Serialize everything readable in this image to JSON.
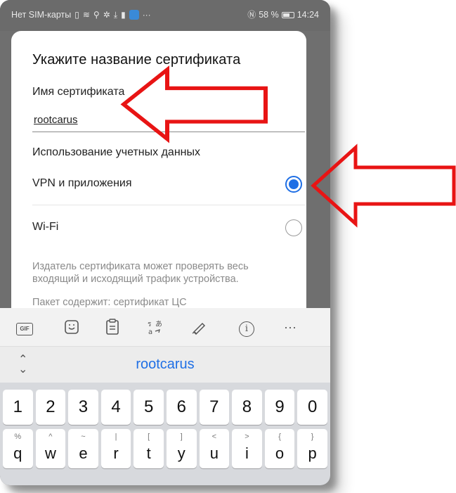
{
  "status_bar": {
    "carrier": "Нет SIM-карты",
    "battery_percent": "58 %",
    "time": "14:24",
    "icons": [
      "sim-icon",
      "wifi-icon",
      "search-icon",
      "settings-icon",
      "download-icon",
      "phone-icon",
      "app-icon",
      "more-icon",
      "nfc-icon",
      "battery-icon"
    ]
  },
  "dialog": {
    "title": "Укажите название сертификата",
    "cert_name_label": "Имя сертификата",
    "cert_name_value": "rootcarus",
    "usage_label": "Использование учетных данных",
    "options": [
      {
        "label": "VPN и приложения",
        "selected": true
      },
      {
        "label": "Wi-Fi",
        "selected": false
      }
    ],
    "note": "Издатель сертификата может проверять весь входящий и исходящий трафик устройства.",
    "note2": "Пакет содержит: сертификат ЦС"
  },
  "keyboard_toolbar": {
    "gif_label": "GIF",
    "icons": [
      "gif-icon",
      "sticker-icon",
      "clipboard-icon",
      "translate-icon",
      "handwriting-icon",
      "info-icon",
      "more-icon"
    ]
  },
  "suggestion": {
    "word": "rootcarus"
  },
  "keyboard": {
    "numbers": [
      "1",
      "2",
      "3",
      "4",
      "5",
      "6",
      "7",
      "8",
      "9",
      "0"
    ],
    "letters": [
      {
        "main": "q",
        "alt": "%"
      },
      {
        "main": "w",
        "alt": "^"
      },
      {
        "main": "e",
        "alt": "~"
      },
      {
        "main": "r",
        "alt": "|"
      },
      {
        "main": "t",
        "alt": "["
      },
      {
        "main": "y",
        "alt": "]"
      },
      {
        "main": "u",
        "alt": "<"
      },
      {
        "main": "i",
        "alt": ">"
      },
      {
        "main": "o",
        "alt": "{"
      },
      {
        "main": "p",
        "alt": "}"
      }
    ]
  },
  "colors": {
    "accent": "#1f6fe5",
    "annotation": "#e81414"
  }
}
